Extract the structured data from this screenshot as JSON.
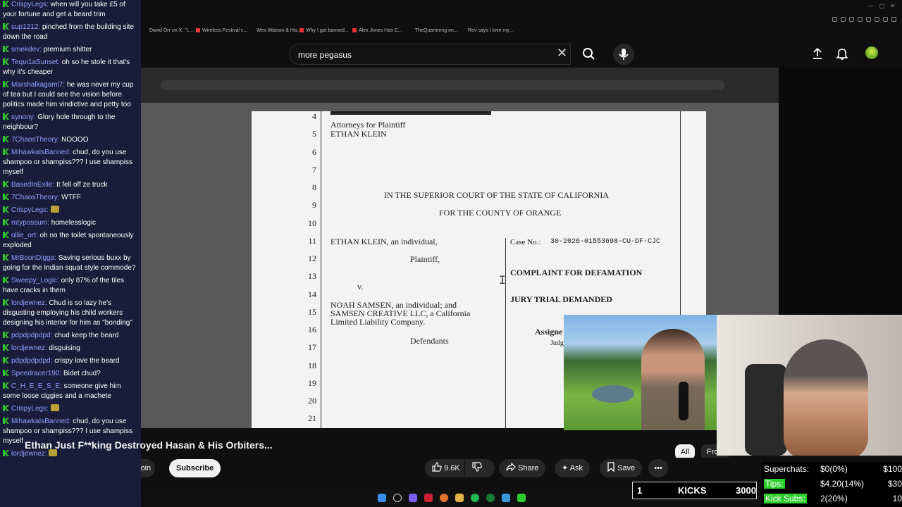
{
  "chat": [
    {
      "user": "CrispyLegs",
      "text": "when will you take £5 of your fortune and get a beard trim"
    },
    {
      "user": "sup1212",
      "text": "pinched from the building site down the road"
    },
    {
      "user": "smekdev",
      "text": "premium shitter"
    },
    {
      "user": "Tequi1aSunset",
      "text": "oh so he stole it that's why it's cheaper"
    },
    {
      "user": "Marshalkagami7",
      "text": "he was never my cup of tea but I could see the vision before politics made him vindictive and petty too"
    },
    {
      "user": "synony",
      "text": "Glory hole through to the neighbour?"
    },
    {
      "user": "7ChaosTheory",
      "text": "NOOOO"
    },
    {
      "user": "MihawkaIsBanned",
      "text": "chud, do you use shampoo or shampiss??? I use shampiss myself"
    },
    {
      "user": "BasedInExile",
      "text": "It fell off ze truck"
    },
    {
      "user": "7ChaosTheory",
      "text": "WTFF"
    },
    {
      "user": "CrispyLegs",
      "text": ""
    },
    {
      "user": "mtypossum",
      "text": "homelesslogic"
    },
    {
      "user": "ollie_ort",
      "text": "oh no the toilet spontaneously exploded"
    },
    {
      "user": "MrBoonDigga",
      "text": "Saving serious buxx by going for the Indian squat style commode?"
    },
    {
      "user": "Sweepy_Logic",
      "text": "only 87% of the tiles have cracks in them"
    },
    {
      "user": "lordjewnez",
      "text": "Chud is so lazy he's disgusting employing his child workers designing his interior for him as \"bonding\""
    },
    {
      "user": "pdpdpdpdpd",
      "text": "chud keep the beard"
    },
    {
      "user": "lordjewnez",
      "text": "disguising"
    },
    {
      "user": "pdpdpdpdpd",
      "text": "crispy love the beard"
    },
    {
      "user": "Speedracer190",
      "text": "Bidet chud?"
    },
    {
      "user": "C_H_E_E_S_E",
      "text": "someone give him some loose ciggies and a machete"
    },
    {
      "user": "CrispyLegs",
      "text": ""
    },
    {
      "user": "MihawkaIsBanned",
      "text": "chud, do you use shampoo or shampiss??? I use shampiss myself"
    },
    {
      "user": "lordjewnez",
      "text": ""
    }
  ],
  "browser": {
    "tabs": [
      "David Orr on X: \"L...",
      "Wireless Festival c...",
      "Wes Watson & His...",
      "Why I got banned...",
      "Alex Jones Has C...",
      "TheQuartering on...",
      "Rev says I love my..."
    ],
    "tab_colors": [
      "#cfcfcf",
      "#e33",
      "#ccc",
      "#e33",
      "#e33",
      "#ccc",
      "#ccc"
    ]
  },
  "youtube": {
    "search_value": "more pegasus",
    "clear_icon": "✕",
    "video_title": "Ethan Just F**king Destroyed Hasan & His Orbiters...",
    "join_label": "Join",
    "subscribe_label": "Subscribe",
    "like_count": "9.6K",
    "share_label": "Share",
    "ask_label": "Ask",
    "save_label": "Save",
    "more_label": "•••",
    "chip_all": "All",
    "chip_from": "From"
  },
  "document": {
    "line_numbers": [
      "4",
      "5",
      "6",
      "7",
      "8",
      "9",
      "10",
      "11",
      "12",
      "13",
      "14",
      "15",
      "16",
      "17",
      "18",
      "19",
      "20",
      "21"
    ],
    "attorneys_line": "Attorneys for Plaintiff",
    "plaintiff_name": "ETHAN KLEIN",
    "court_line1": "IN THE SUPERIOR COURT OF THE STATE OF CALIFORNIA",
    "court_line2": "FOR THE COUNTY OF ORANGE",
    "party1": "ETHAN KLEIN, an individual,",
    "party1_role": "Plaintiff,",
    "versus": "v.",
    "party2_line1": "NOAH SAMSEN, an individual; and",
    "party2_line2": "SAMSEN CREATIVE LLC, a California",
    "party2_line3": "Limited Liability Company.",
    "party2_role": "Defendants",
    "case_no_label": "Case No.:",
    "case_no": "30-2026-01553698-CU-DF-CJC",
    "complaint": "COMPLAINT FOR DEFAMATION",
    "jury": "JURY TRIAL DEMANDED",
    "assigned": "Assigne",
    "judge": "Judg"
  },
  "stream": {
    "superchats_label": "Superchats:",
    "superchats_value": "$0(0%)",
    "superchats_goal": "$100",
    "tips_label": "Tips:",
    "tips_value": "$4.20(14%)",
    "tips_goal": "$30",
    "kicksubs_label": "Kick Subs:",
    "kicksubs_value": "2(20%)",
    "kicksubs_goal": "10",
    "kicks_count": "1",
    "kicks_label": "KICKS",
    "kicks_goal": "3000"
  }
}
